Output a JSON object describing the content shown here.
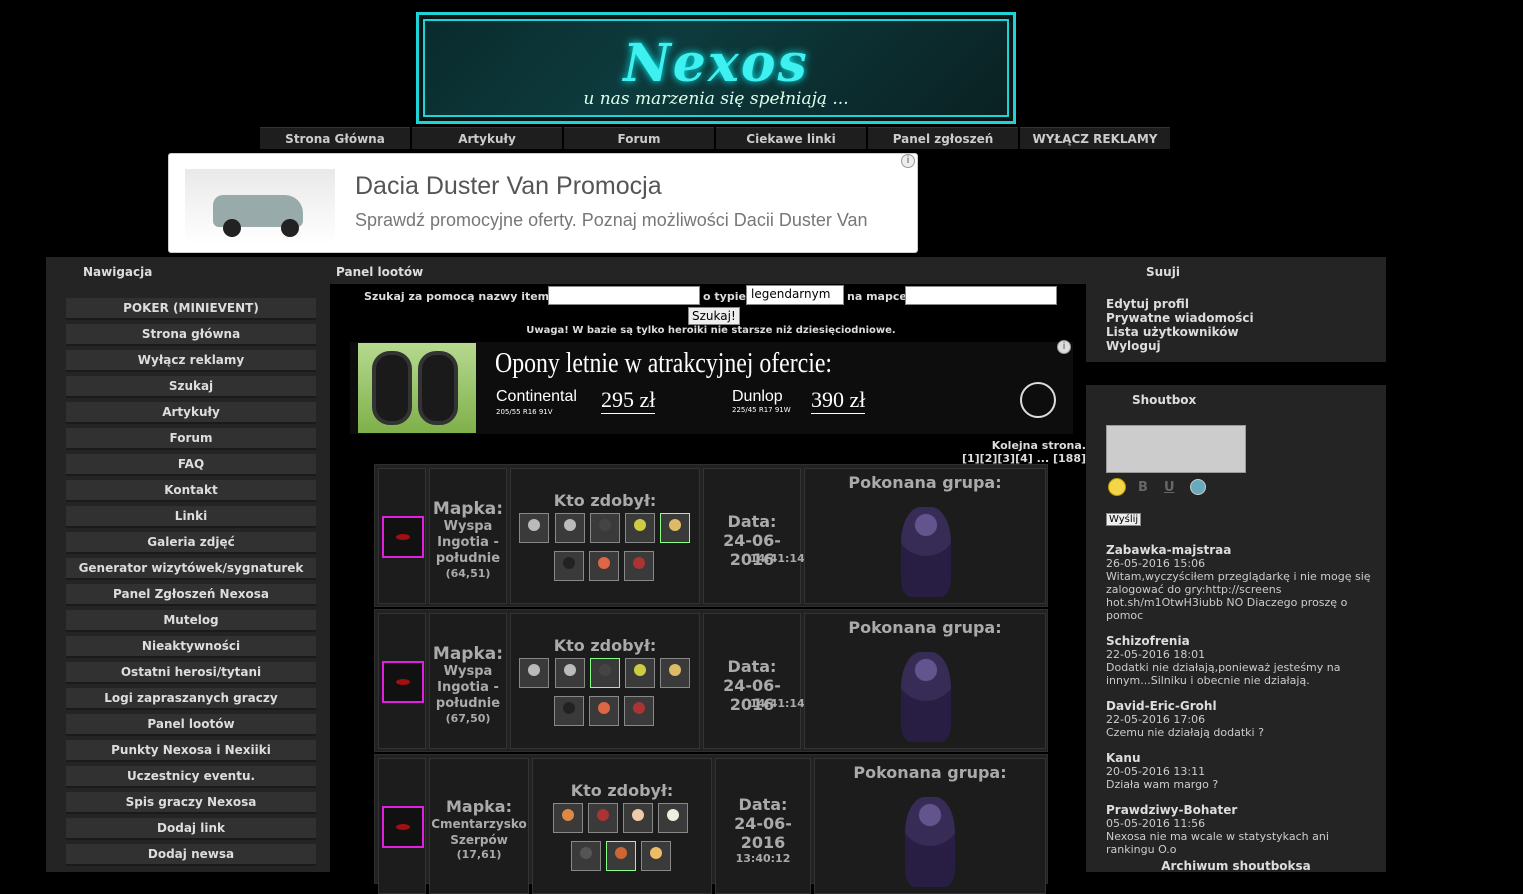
{
  "header": {
    "logo": "Nexos",
    "tagline": "u nas marzenia się spełniają ..."
  },
  "topnav": [
    "Strona Główna",
    "Artykuły",
    "Forum",
    "Ciekawe linki",
    "Panel zgłoszeń",
    "WYŁĄCZ REKLAMY"
  ],
  "ad_top": {
    "title": "Dacia Duster Van Promocja",
    "text": "Sprawdź promocyjne oferty. Poznaj możliwości Dacii Duster Van",
    "info": "i"
  },
  "left": {
    "title": "Nawigacja",
    "items": [
      "POKER (MINIEVENT)",
      "Strona główna",
      "Wyłącz reklamy",
      "Szukaj",
      "Artykuły",
      "Forum",
      "FAQ",
      "Kontakt",
      "Linki",
      "Galeria zdjęć",
      "Generator wizytówek/sygnaturek",
      "Panel Zgłoszeń Nexosa",
      "Mutelog",
      "Nieaktywności",
      "Ostatni herosi/tytani",
      "Logi zapraszanych graczy",
      "Panel lootów",
      "Punkty Nexosa i Nexiiki",
      "Uczestnicy eventu.",
      "Spis graczy Nexosa",
      "Dodaj link",
      "Dodaj newsa"
    ]
  },
  "center": {
    "title": "Panel lootów",
    "search_label": "Szukaj za pomocą nazwy itemu:",
    "type_label": "o typie",
    "type_value": "legendarnym",
    "map_label": "na mapce",
    "search_button": "Szukaj!",
    "warning": "Uwaga! W bazie są tylko heroiki nie starsze niż dziesięciodniowe.",
    "next_page": "Kolejna strona.",
    "pages": "[1][2][3][4] ... [188]"
  },
  "ad_tires": {
    "headline": "Opony letnie w atrakcyjnej ofercie:",
    "offers": [
      {
        "brand": "Continental",
        "size": "205/55 R16 91V",
        "price": "295 zł"
      },
      {
        "brand": "Dunlop",
        "size": "225/45 R17 91W",
        "price": "390 zł"
      }
    ],
    "info": "i"
  },
  "loot_rows": [
    {
      "map_label": "Mapka:",
      "map_name": "Wyspa Ingotia - południe",
      "coords": "(64,51)",
      "who_label": "Kto zdobył:",
      "date_label": "Data:",
      "date": "24-06-2016",
      "time": "14:41:14",
      "group_label": "Pokonana grupa:"
    },
    {
      "map_label": "Mapka:",
      "map_name": "Wyspa Ingotia - południe",
      "coords": "(67,50)",
      "who_label": "Kto zdobył:",
      "date_label": "Data:",
      "date": "24-06-2016",
      "time": "14:41:14",
      "group_label": "Pokonana grupa:"
    },
    {
      "map_label": "Mapka:",
      "map_name": "Cmentarzysko Szerpów",
      "coords": "(17,61)",
      "who_label": "Kto zdobył:",
      "date_label": "Data:",
      "date": "24-06-2016",
      "time": "13:40:12",
      "group_label": "Pokonana grupa:"
    }
  ],
  "right": {
    "user_title": "Suuji",
    "user_links": [
      "Edytuj profil",
      "Prywatne wiadomości",
      "Lista użytkowników",
      "Wyloguj"
    ],
    "shoutbox_title": "Shoutbox",
    "send_button": "Wyślij",
    "archive": "Archiwum shoutboksa",
    "shouts": [
      {
        "name": "Zabawka-majstraa",
        "date": "26-05-2016 15:06",
        "msg": "Witam,wyczyściłem przeglądarkę i nie mogę się zalogować do gry:http://screens hot.sh/m1OtwH3iubb NO Diaczego proszę o pomoc"
      },
      {
        "name": "Schizofrenia",
        "date": "22-05-2016 18:01",
        "msg": "Dodatki nie działają,ponieważ jesteśmy na innym...Silniku i obecnie nie działają."
      },
      {
        "name": "David-Eric-Grohl",
        "date": "22-05-2016 17:06",
        "msg": "Czemu nie działają dodatki ?"
      },
      {
        "name": "Kanu",
        "date": "20-05-2016 13:11",
        "msg": "Działa wam margo ?"
      },
      {
        "name": "Prawdziwy-Bohater",
        "date": "05-05-2016 11:56",
        "msg": "Nexosa nie ma wcale w statystykach ani rankingu O.o"
      }
    ]
  }
}
